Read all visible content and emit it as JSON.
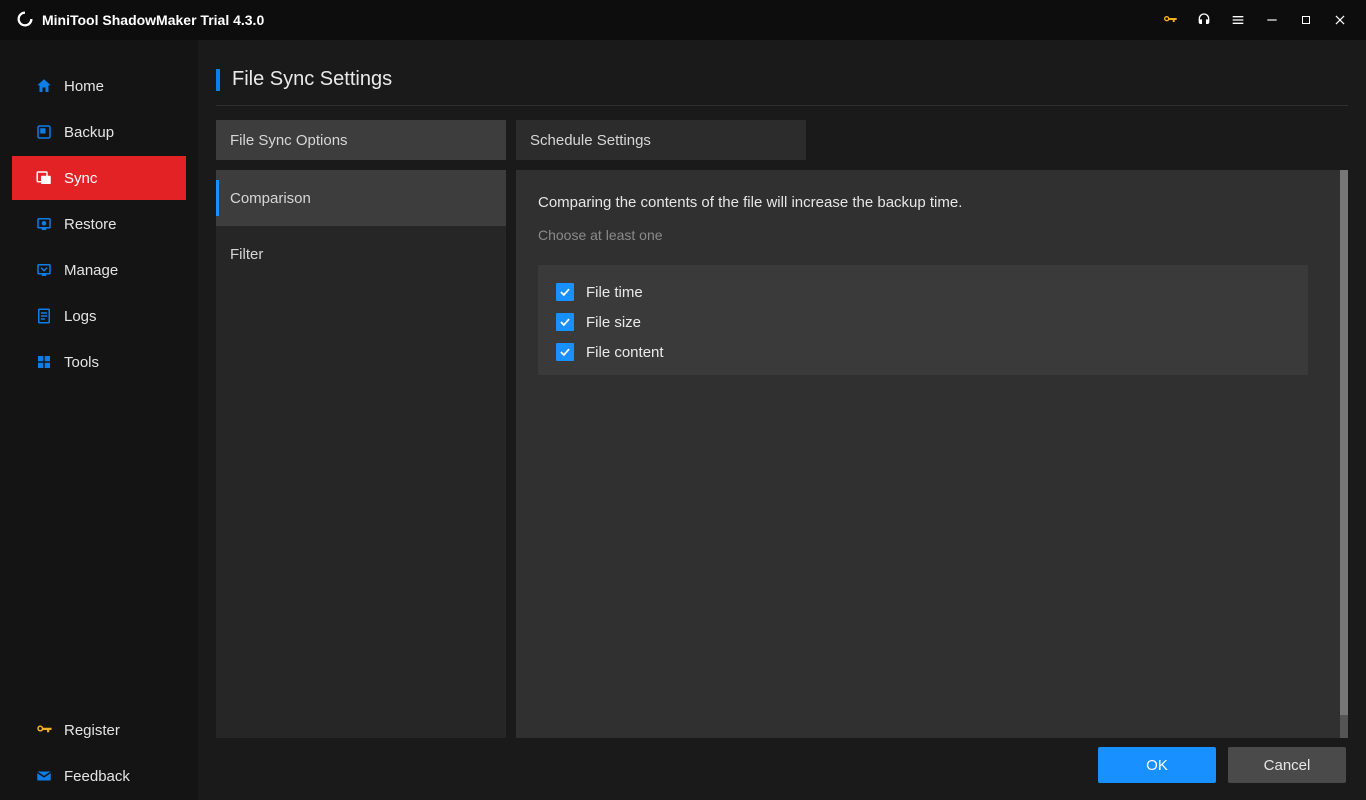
{
  "titlebar": {
    "app_title": "MiniTool ShadowMaker Trial 4.3.0"
  },
  "sidebar": {
    "items": [
      {
        "label": "Home"
      },
      {
        "label": "Backup"
      },
      {
        "label": "Sync"
      },
      {
        "label": "Restore"
      },
      {
        "label": "Manage"
      },
      {
        "label": "Logs"
      },
      {
        "label": "Tools"
      }
    ],
    "bottom": [
      {
        "label": "Register"
      },
      {
        "label": "Feedback"
      }
    ]
  },
  "page": {
    "title": "File Sync Settings",
    "tabs": [
      {
        "label": "File Sync Options"
      },
      {
        "label": "Schedule Settings"
      }
    ],
    "sub_items": [
      {
        "label": "Comparison"
      },
      {
        "label": "Filter"
      }
    ],
    "panel": {
      "info": "Comparing the contents of the file will increase the backup time.",
      "hint": "Choose at least one",
      "checks": [
        {
          "label": "File time"
        },
        {
          "label": "File size"
        },
        {
          "label": "File content"
        }
      ]
    }
  },
  "footer": {
    "ok": "OK",
    "cancel": "Cancel"
  }
}
